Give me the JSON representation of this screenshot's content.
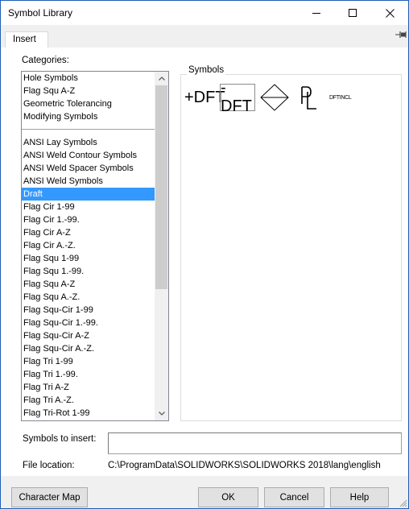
{
  "window": {
    "title": "Symbol Library",
    "minimize_icon": "minimize-icon",
    "maximize_icon": "maximize-icon",
    "close_icon": "close-icon"
  },
  "tabs": [
    {
      "label": "Insert",
      "active": true
    }
  ],
  "pin_icon": "pin-icon",
  "categories": {
    "label": "Categories:",
    "items": [
      {
        "label": "Hole Symbols"
      },
      {
        "label": "Flag Squ A-Z"
      },
      {
        "label": "Geometric Tolerancing"
      },
      {
        "label": "Modifying Symbols"
      },
      {
        "label": "",
        "separator": true
      },
      {
        "label": "ANSI Lay Symbols"
      },
      {
        "label": "ANSI Weld Contour Symbols"
      },
      {
        "label": "ANSI Weld Spacer Symbols"
      },
      {
        "label": "ANSI Weld Symbols"
      },
      {
        "label": "Draft",
        "selected": true
      },
      {
        "label": "Flag Cir 1-99"
      },
      {
        "label": "Flag Cir 1.-99."
      },
      {
        "label": "Flag Cir A-Z"
      },
      {
        "label": "Flag Cir A.-Z."
      },
      {
        "label": "Flag Squ 1-99"
      },
      {
        "label": "Flag Squ 1.-99."
      },
      {
        "label": "Flag Squ A-Z"
      },
      {
        "label": "Flag Squ A.-Z."
      },
      {
        "label": "Flag Squ-Cir 1-99"
      },
      {
        "label": "Flag Squ-Cir 1.-99."
      },
      {
        "label": "Flag Squ-Cir A-Z"
      },
      {
        "label": "Flag Squ-Cir A.-Z."
      },
      {
        "label": "Flag Tri 1-99"
      },
      {
        "label": "Flag Tri 1.-99."
      },
      {
        "label": "Flag Tri A-Z"
      },
      {
        "label": "Flag Tri A.-Z."
      },
      {
        "label": "Flag Tri-Rot 1-99"
      }
    ]
  },
  "symbols": {
    "label": "Symbols",
    "items": [
      {
        "name": "plus-draft",
        "text": "+DFT"
      },
      {
        "name": "minus-draft",
        "text": "-DFT",
        "selected": true
      },
      {
        "name": "diamond-draft",
        "icon": "diamond-icon"
      },
      {
        "name": "parting-line",
        "icon": "parting-line-icon"
      },
      {
        "name": "draft-incl",
        "text": "DFTINCL"
      }
    ]
  },
  "insert": {
    "label": "Symbols to insert:",
    "value": ""
  },
  "file_location": {
    "label": "File location:",
    "value": "C:\\ProgramData\\SOLIDWORKS\\SOLIDWORKS 2018\\lang\\english"
  },
  "buttons": {
    "character_map": "Character Map",
    "ok": "OK",
    "cancel": "Cancel",
    "help": "Help"
  }
}
